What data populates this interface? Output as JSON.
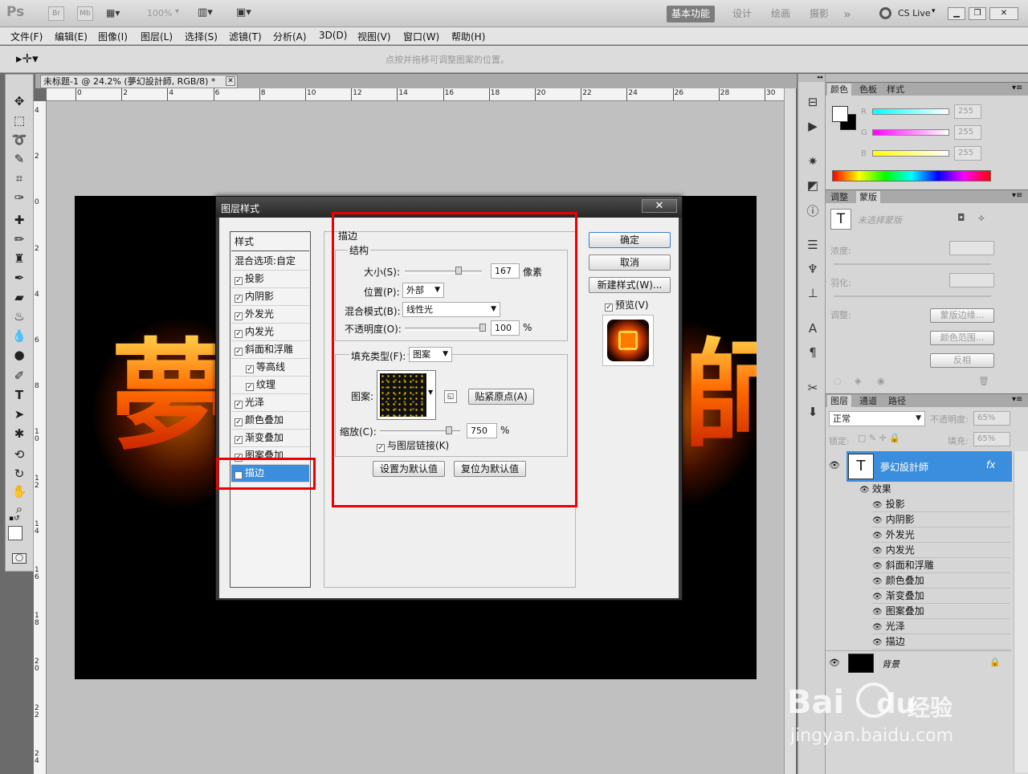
{
  "app": {
    "logo": "Ps",
    "br": "Br",
    "mb": "Mb",
    "zoom": "100%",
    "workspaces": [
      "基本功能",
      "设计",
      "绘画",
      "摄影"
    ],
    "more": "»",
    "cslive": "CS Live"
  },
  "menu": [
    "文件(F)",
    "编辑(E)",
    "图像(I)",
    "图层(L)",
    "选择(S)",
    "滤镜(T)",
    "分析(A)",
    "3D(D)",
    "视图(V)",
    "窗口(W)",
    "帮助(H)"
  ],
  "options": {
    "hint": "点按并拖移可调整图案的位置。"
  },
  "document": {
    "tab": "未标题-1 @ 24.2% (夢幻設計師, RGB/8) *",
    "ruler_top": [
      "0",
      "2",
      "4",
      "6",
      "8",
      "10",
      "12",
      "14",
      "16",
      "18",
      "20",
      "22",
      "24",
      "26",
      "28",
      "30"
    ],
    "ruler_left": [
      "4",
      "2",
      "0",
      "2",
      "4",
      "6",
      "8",
      "1 0",
      "1 2",
      "1 4",
      "1 6",
      "1 8",
      "2 0",
      "2 2",
      "2 4"
    ],
    "canvas_text_left": "夢",
    "canvas_text_right": "師"
  },
  "dialog": {
    "title": "图层样式",
    "close": "✕",
    "styles_header": "样式",
    "blend": "混合选项:自定",
    "styles": [
      {
        "label": "投影",
        "checked": true
      },
      {
        "label": "内阴影",
        "checked": true
      },
      {
        "label": "外发光",
        "checked": true
      },
      {
        "label": "内发光",
        "checked": true
      },
      {
        "label": "斜面和浮雕",
        "checked": true
      },
      {
        "label": "等高线",
        "checked": true
      },
      {
        "label": "纹理",
        "checked": true
      },
      {
        "label": "光泽",
        "checked": true
      },
      {
        "label": "颜色叠加",
        "checked": true
      },
      {
        "label": "渐变叠加",
        "checked": true
      },
      {
        "label": "图案叠加",
        "checked": true
      },
      {
        "label": "描边",
        "checked": true
      }
    ],
    "stroke_title": "描边",
    "structure": "结构",
    "size_label": "大小(S):",
    "size": "167",
    "size_unit": "像素",
    "position_label": "位置(P):",
    "position": "外部",
    "blendmode_label": "混合模式(B):",
    "blendmode": "线性光",
    "opacity_label": "不透明度(O):",
    "opacity": "100",
    "opacity_unit": "%",
    "filltype_label": "填充类型(F):",
    "filltype": "图案",
    "pattern_label": "图案:",
    "snap": "贴紧原点(A)",
    "scale_label": "缩放(C):",
    "scale": "750",
    "scale_unit": "%",
    "link_label": "与图层链接(K)",
    "set_default": "设置为默认值",
    "reset_default": "复位为默认值",
    "ok": "确定",
    "cancel": "取消",
    "new_style": "新建样式(W)...",
    "preview": "预览(V)"
  },
  "color_panel": {
    "tabs": [
      "颜色",
      "色板",
      "样式"
    ],
    "r_label": "R",
    "g_label": "G",
    "b_label": "B",
    "r": "255",
    "g": "255",
    "b": "255"
  },
  "adjust_panel": {
    "tabs": [
      "调整",
      "蒙版"
    ],
    "mask_label": "未选择蒙版",
    "density": "浓度:",
    "feather": "羽化:",
    "refine": "调整:",
    "mask_edge": "蒙版边缘...",
    "color_range": "颜色范围...",
    "invert": "反相"
  },
  "layers_panel": {
    "tabs": [
      "图层",
      "通道",
      "路径"
    ],
    "blend": "正常",
    "opacity_label": "不透明度:",
    "opacity": "65%",
    "lock_label": "锁定:",
    "fill_label": "填充:",
    "fill": "65%",
    "text_layer": "夢幻設計師",
    "fx": "fx",
    "effects_label": "效果",
    "effects": [
      "投影",
      "内阴影",
      "外发光",
      "内发光",
      "斜面和浮雕",
      "颜色叠加",
      "渐变叠加",
      "图案叠加",
      "光泽",
      "描边"
    ],
    "bg_layer": "背景"
  },
  "watermark": {
    "logo": "Bai",
    "logo2": "du",
    "text1": "经验",
    "url": "jingyan.baidu.com"
  },
  "colors": {
    "accent": "#3b8ede",
    "highlight_box": "#ee0000",
    "layer_selected": "#3b8ede"
  }
}
